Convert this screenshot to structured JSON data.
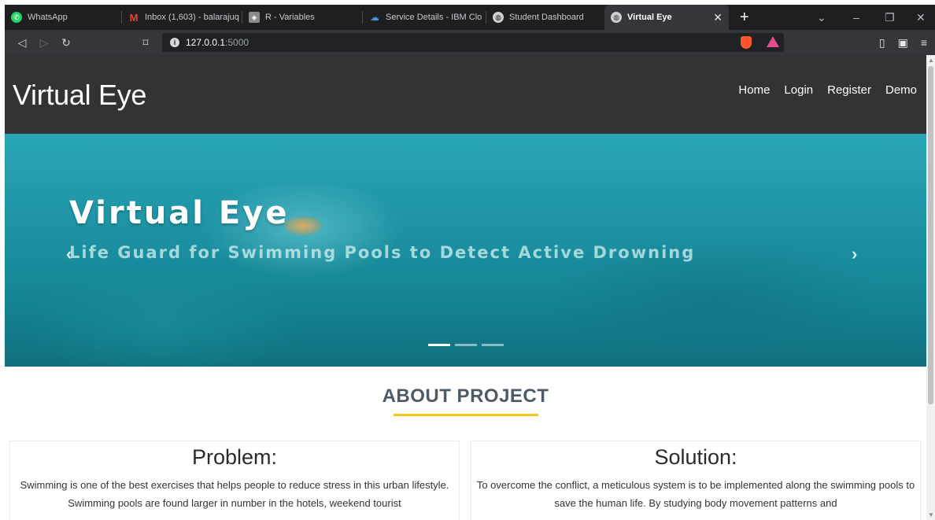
{
  "browser": {
    "tabs": [
      {
        "title": "WhatsApp",
        "icon": "whatsapp-icon",
        "color": "#25d366"
      },
      {
        "title": "Inbox (1,603) - balarajuq",
        "icon": "gmail-icon",
        "color": "#ea4335"
      },
      {
        "title": "R - Variables",
        "icon": "site-icon",
        "color": "#8a8a8a"
      },
      {
        "title": "Service Details - IBM Clo",
        "icon": "cloud-icon",
        "color": "#4a90e2"
      },
      {
        "title": "Student Dashboard",
        "icon": "globe-icon",
        "color": "#cfcfcf"
      },
      {
        "title": "Virtual Eye",
        "icon": "globe-icon",
        "color": "#cfcfcf",
        "active": true
      }
    ],
    "url_host": "127.0.0.1",
    "url_port": ":5000"
  },
  "site": {
    "brand": "Virtual Eye",
    "nav": [
      "Home",
      "Login",
      "Register",
      "Demo"
    ]
  },
  "hero": {
    "title": "Virtual Eye",
    "subtitle": "Life Guard for Swimming Pools to Detect Active Drowning",
    "slides": 3,
    "active_slide": 0
  },
  "about": {
    "heading": "ABOUT PROJECT",
    "accent": "#f5c518",
    "problem": {
      "title": "Problem:",
      "text": "Swimming is one of the best exercises that helps people to reduce stress in this urban lifestyle. Swimming pools are found larger in number in the hotels, weekend tourist"
    },
    "solution": {
      "title": "Solution:",
      "text": "To overcome the conflict, a meticulous system is to be implemented along the swimming pools to save the human life. By studying body movement patterns and"
    }
  }
}
